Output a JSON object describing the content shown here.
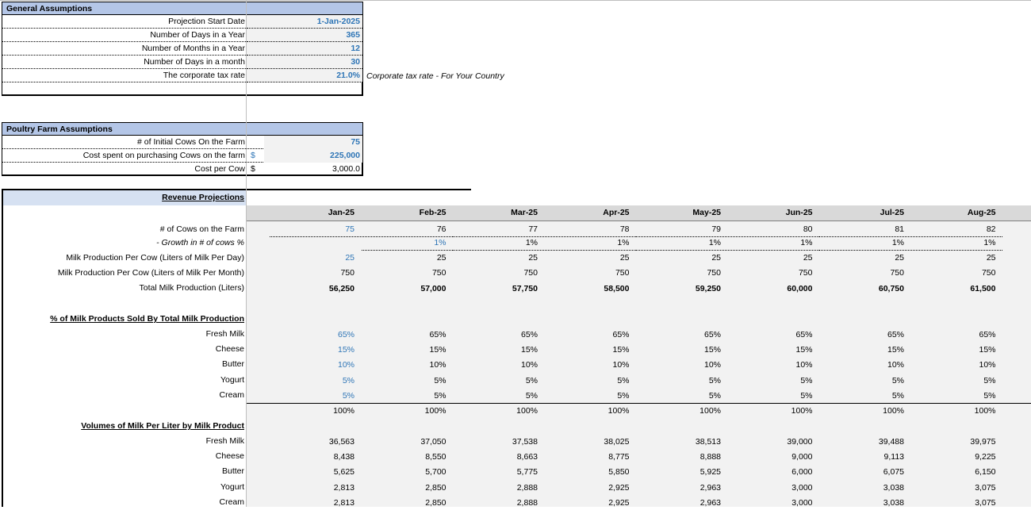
{
  "general": {
    "title": "General Assumptions",
    "rows": [
      {
        "label": "Projection Start Date",
        "value": "1-Jan-2025"
      },
      {
        "label": "Number of Days in a Year",
        "value": "365"
      },
      {
        "label": "Number of Months in a Year",
        "value": "12"
      },
      {
        "label": "Number of Days in a month",
        "value": "30"
      },
      {
        "label": "The corporate tax rate",
        "value": "21.0%"
      }
    ],
    "tax_note": "Corporate tax rate - For Your Country"
  },
  "farm": {
    "title": "Poultry Farm Assumptions",
    "rows": [
      {
        "label": "# of Initial Cows On the Farm",
        "currency": "",
        "value": "75"
      },
      {
        "label": "Cost spent on purchasing Cows on the farm",
        "currency": "$",
        "value": "225,000"
      },
      {
        "label": "Cost per Cow",
        "currency": "$",
        "value": "3,000.0"
      }
    ]
  },
  "revenue": {
    "title": "Revenue Projections",
    "months": [
      "Jan-25",
      "Feb-25",
      "Mar-25",
      "Apr-25",
      "May-25",
      "Jun-25",
      "Jul-25",
      "Aug-25"
    ],
    "cows_label": "# of Cows on the Farm",
    "cows": [
      "75",
      "76",
      "77",
      "78",
      "79",
      "80",
      "81",
      "82"
    ],
    "growth_label": "- Growth in # of cows %",
    "growth": [
      "",
      "1%",
      "1%",
      "1%",
      "1%",
      "1%",
      "1%",
      "1%"
    ],
    "prod_day_label": "Milk Production Per Cow (Liters of Milk Per Day)",
    "prod_day": [
      "25",
      "25",
      "25",
      "25",
      "25",
      "25",
      "25",
      "25"
    ],
    "prod_month_label": "Milk Production Per Cow (Liters of Milk Per Month)",
    "prod_month": [
      "750",
      "750",
      "750",
      "750",
      "750",
      "750",
      "750",
      "750"
    ],
    "total_label": "Total Milk Production (Liters)",
    "total": [
      "56,250",
      "57,000",
      "57,750",
      "58,500",
      "59,250",
      "60,000",
      "60,750",
      "61,500"
    ],
    "pct_title": "% of Milk Products Sold By Total Milk Production",
    "products": [
      {
        "name": "Fresh Milk",
        "pct": [
          "65%",
          "65%",
          "65%",
          "65%",
          "65%",
          "65%",
          "65%",
          "65%"
        ],
        "vol": [
          "36,563",
          "37,050",
          "37,538",
          "38,025",
          "38,513",
          "39,000",
          "39,488",
          "39,975"
        ]
      },
      {
        "name": "Cheese",
        "pct": [
          "15%",
          "15%",
          "15%",
          "15%",
          "15%",
          "15%",
          "15%",
          "15%"
        ],
        "vol": [
          "8,438",
          "8,550",
          "8,663",
          "8,775",
          "8,888",
          "9,000",
          "9,113",
          "9,225"
        ]
      },
      {
        "name": "Butter",
        "pct": [
          "10%",
          "10%",
          "10%",
          "10%",
          "10%",
          "10%",
          "10%",
          "10%"
        ],
        "vol": [
          "5,625",
          "5,700",
          "5,775",
          "5,850",
          "5,925",
          "6,000",
          "6,075",
          "6,150"
        ]
      },
      {
        "name": "Yogurt",
        "pct": [
          "5%",
          "5%",
          "5%",
          "5%",
          "5%",
          "5%",
          "5%",
          "5%"
        ],
        "vol": [
          "2,813",
          "2,850",
          "2,888",
          "2,925",
          "2,963",
          "3,000",
          "3,038",
          "3,075"
        ]
      },
      {
        "name": "Cream",
        "pct": [
          "5%",
          "5%",
          "5%",
          "5%",
          "5%",
          "5%",
          "5%",
          "5%"
        ],
        "vol": [
          "2,813",
          "2,850",
          "2,888",
          "2,925",
          "2,963",
          "3,000",
          "3,038",
          "3,075"
        ]
      }
    ],
    "pct_total": [
      "100%",
      "100%",
      "100%",
      "100%",
      "100%",
      "100%",
      "100%",
      "100%"
    ],
    "vol_title": "Volumes of Milk Per Liter by Milk Product"
  },
  "colors": {
    "header": "#b4c6e7",
    "input_blue": "#2e75b6",
    "grid": "#f2f2f2",
    "month_header": "#d9d9d9"
  }
}
